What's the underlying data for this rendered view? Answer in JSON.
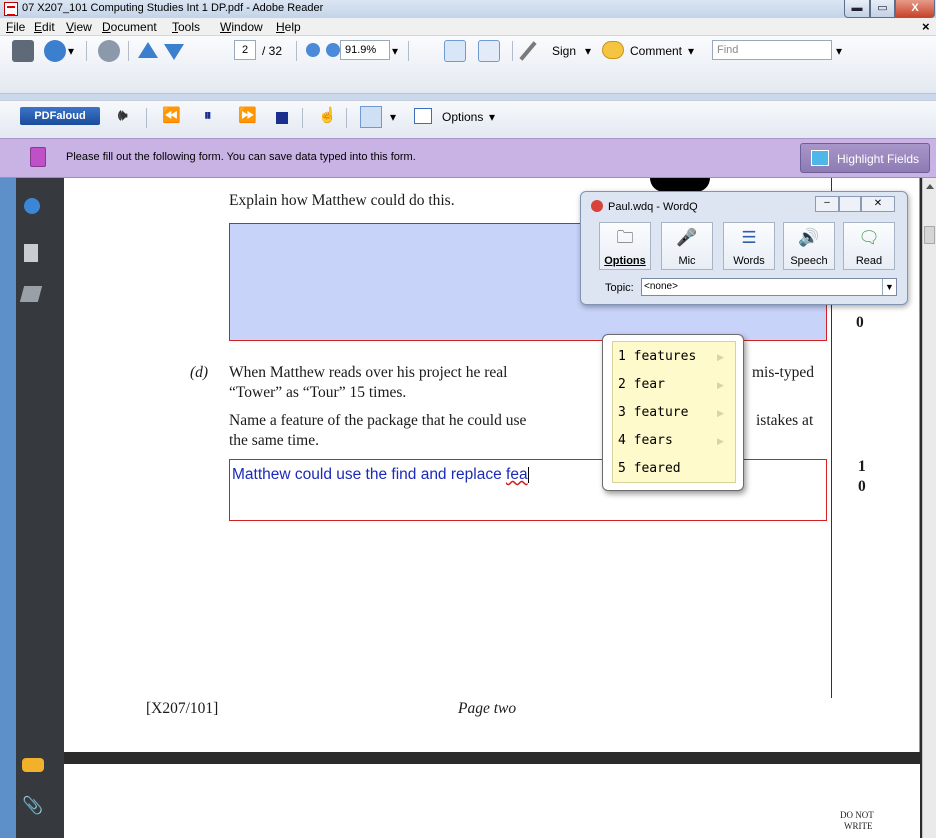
{
  "window": {
    "title": "07 X207_101 Computing Studies Int 1 DP.pdf - Adobe Reader",
    "min_glyph": "▬",
    "max_glyph": "▭",
    "close_glyph": "X"
  },
  "menu": {
    "items": [
      "File",
      "Edit",
      "View",
      "Document",
      "Tools",
      "Window",
      "Help"
    ],
    "close_glyph": "×"
  },
  "toolbar": {
    "page_current": "2",
    "page_total": "/ 32",
    "zoom": "91.9%",
    "sign_label": "Sign",
    "comment_label": "Comment",
    "find_placeholder": "Find",
    "dropdown_glyph": "▾"
  },
  "toolbar2": {
    "pdfaloud_label": "PDFaloud",
    "options_label": "Options",
    "dropdown_glyph": "▾"
  },
  "formbar": {
    "message": "Please fill out the following form. You can save data typed into this form.",
    "highlight_label": "Highlight Fields"
  },
  "document": {
    "question_c_tail": "Explain how Matthew could do this.",
    "marks_c_bottom": "0",
    "question_d_label": "(d)",
    "question_d_line1_a": "When Matthew reads over his project he real",
    "question_d_line1_b": "mis-typed",
    "question_d_line2": "“Tower” as “Tour” 15 times.",
    "question_d_line3_a": "Name a feature of the package that he could use",
    "question_d_line3_b": "istakes at",
    "question_d_line4": "the same time.",
    "answer_d_text": "Matthew could use the find and replace ",
    "answer_d_current_word": "fea",
    "marks_d_top": "1",
    "marks_d_bottom": "0",
    "footer_code": "[X207/101]",
    "footer_page": "Page two",
    "page2_margin_line1": "DO NOT",
    "page2_margin_line2": "WRITE"
  },
  "wordq": {
    "title": "Paul.wdq - WordQ",
    "buttons": [
      {
        "label": "Options",
        "icon": "folder-icon"
      },
      {
        "label": "Mic",
        "icon": "microphone-icon"
      },
      {
        "label": "Words",
        "icon": "list-icon"
      },
      {
        "label": "Speech",
        "icon": "speaker-icon"
      },
      {
        "label": "Read",
        "icon": "speech-bubble-icon"
      }
    ],
    "topic_label": "Topic:",
    "topic_value": "<none>"
  },
  "predictions": {
    "items": [
      "1 features",
      "2 fear",
      "3 feature",
      "4 fears",
      "5 feared"
    ],
    "arrow_glyph": "▶"
  },
  "colors": {
    "form_bar": "#c9b3e5",
    "field_fill": "#c8d3fa",
    "field_border": "#d32020",
    "answer_text": "#1b2bb8",
    "prediction_bg": "#fefacb"
  }
}
